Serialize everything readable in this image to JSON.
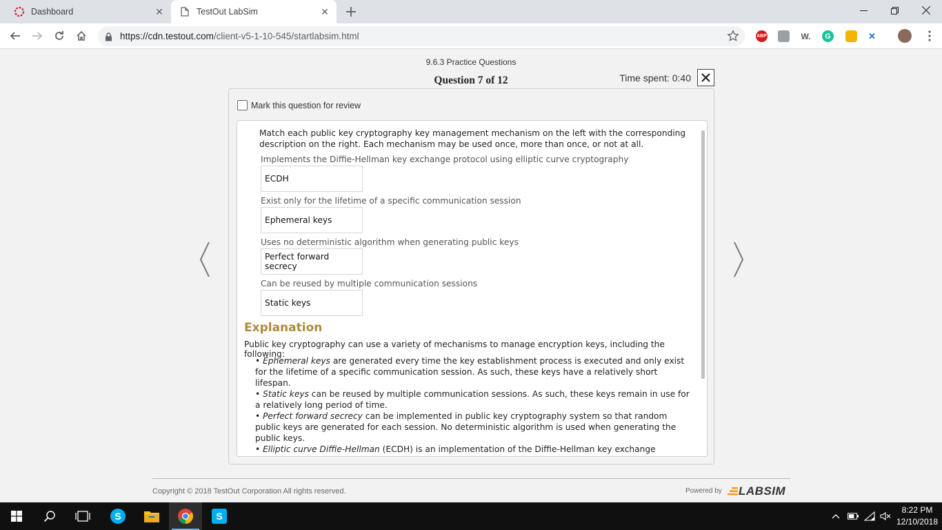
{
  "browser": {
    "tabs": [
      {
        "title": "Dashboard",
        "active": false,
        "icon": "testout-circle-icon"
      },
      {
        "title": "TestOut LabSim",
        "active": true,
        "icon": "page-icon"
      }
    ],
    "url_host": "https://cdn.testout.com",
    "url_path": "/client-v5-1-10-545/startlabsim.html",
    "extensions": [
      {
        "name": "adblock-icon",
        "label": "ABP",
        "color": "#d51a1a"
      },
      {
        "name": "extension-gray-icon",
        "label": "",
        "color": "#9aa0a6"
      },
      {
        "name": "w-extension-icon",
        "label": "W.",
        "color": "#555555"
      },
      {
        "name": "grammarly-icon",
        "label": "G",
        "color": "#15c39a"
      },
      {
        "name": "coin-extension-icon",
        "label": "",
        "color": "#f2b400"
      },
      {
        "name": "arrows-extension-icon",
        "label": "",
        "color": "#1a73e8"
      }
    ]
  },
  "quiz": {
    "name": "9.6.3 Practice Questions",
    "question_label": "Question 7 of 12",
    "time_spent": "Time spent: 0:40",
    "review_label": "Mark this question for review",
    "prompt": "Match each public key cryptography key management mechanism on the left with the corresponding description on the right. Each mechanism may be used once, more than once, or not at all.",
    "matches": [
      {
        "description": "Implements the Diffie-Hellman key exchange protocol using elliptic curve cryptography",
        "answer": "ECDH"
      },
      {
        "description": "Exist only for the lifetime of a specific communication session",
        "answer": "Ephemeral keys"
      },
      {
        "description": "Uses no deterministic algorithm when generating public keys",
        "answer": "Perfect forward secrecy"
      },
      {
        "description": "Can be reused by multiple communication sessions",
        "answer": "Static keys"
      }
    ],
    "explanation": {
      "title": "Explanation",
      "intro": "Public key cryptography can use a variety of mechanisms to manage encryption keys, including the following:",
      "items": [
        {
          "term": "Ephemeral keys",
          "text": " are generated every time the key establishment process is executed and only exist for the lifetime of a specific communication session. As such, these keys have a relatively short lifespan."
        },
        {
          "term": "Static keys",
          "text": " can be reused by multiple communication sessions. As such, these keys remain in use for a relatively long period of time."
        },
        {
          "term": "Perfect forward secrecy",
          "text": " can be implemented in public key cryptography system so that random public keys are generated for each session. No deterministic algorithm is used when generating the public keys."
        },
        {
          "term": "Elliptic curve Diffie-Hellman",
          "text": " (ECDH) is an implementation of the Diffie-Hellman key exchange protocol using elliptic curve cryptography. It allows two parties, each having their own elliptic curve public/private key pair, to generate symmetric keys simultaneously over a non-secure channel."
        }
      ]
    }
  },
  "footer": {
    "copyright": "Copyright © 2018 TestOut Corporation All rights reserved.",
    "powered_by": "Powered by",
    "logo_text": "LABSIM"
  },
  "taskbar": {
    "time": "8:22 PM",
    "date": "12/10/2018"
  }
}
